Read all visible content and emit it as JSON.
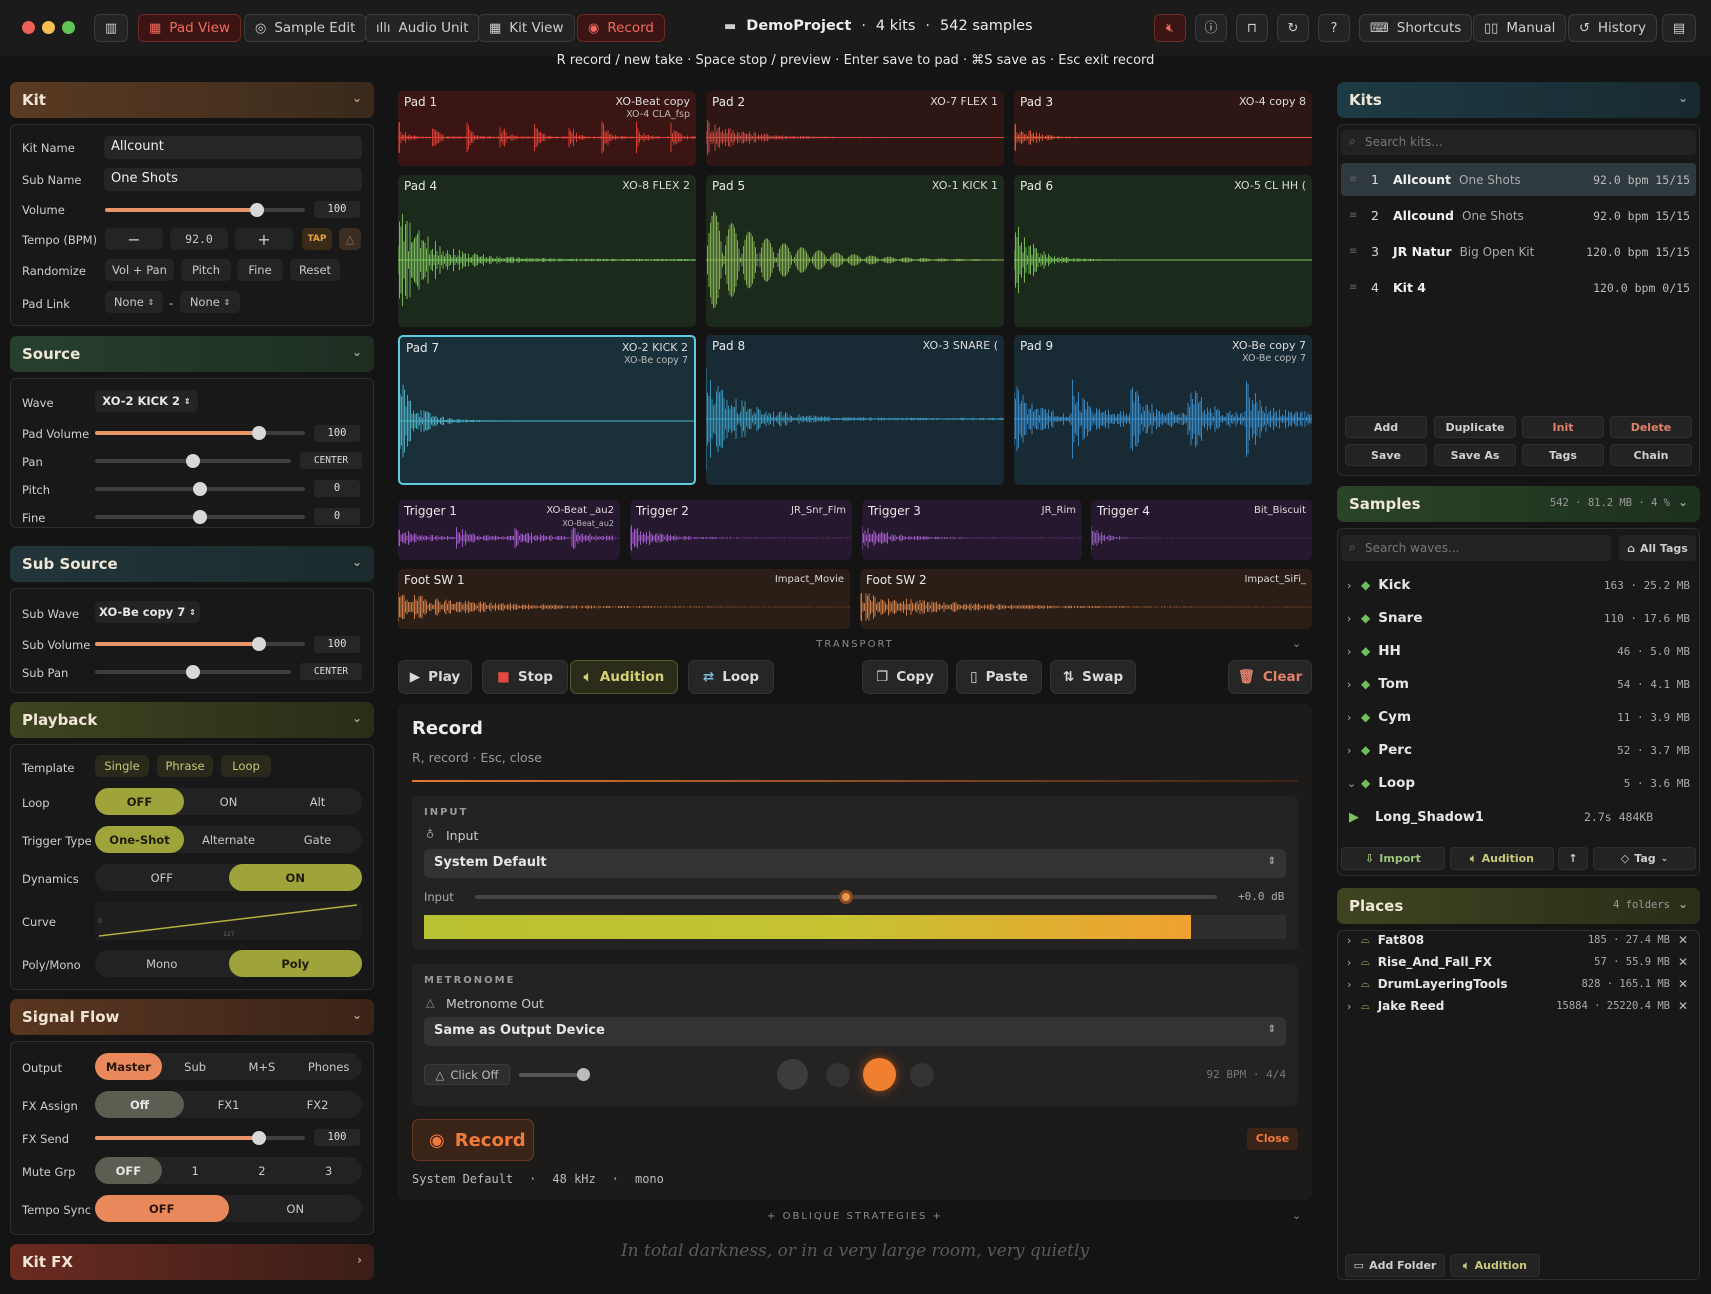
{
  "titlebar": {
    "tabs": [
      "Pad View",
      "Sample Edit",
      "Audio Unit",
      "Kit View",
      "Record"
    ],
    "project": "DemoProject",
    "kits": "4 kits",
    "samples": "542 samples",
    "shortcuts": "Shortcuts",
    "manual": "Manual",
    "history": "History"
  },
  "hint": "R record / new take · Space stop / preview · Enter save to pad · ⌘S save as · Esc exit record",
  "kit": {
    "title": "Kit",
    "kit_name_label": "Kit Name",
    "kit_name": "Allcount",
    "sub_name_label": "Sub Name",
    "sub_name": "One Shots",
    "volume_label": "Volume",
    "volume": "100",
    "volume_level": 0.76,
    "tempo_label": "Tempo (BPM)",
    "tempo": "92.0",
    "minus": "−",
    "plus": "+",
    "tap": "TAP",
    "randomize_label": "Randomize",
    "randomize": [
      "Vol + Pan",
      "Pitch",
      "Fine",
      "Reset"
    ],
    "padlink_label": "Pad Link",
    "padlink_a": "None",
    "padlink_sep": "-",
    "padlink_b": "None"
  },
  "source": {
    "title": "Source",
    "wave_label": "Wave",
    "wave": "XO-2 KICK 2",
    "padvol_label": "Pad Volume",
    "padvol": "100",
    "padvol_level": 0.78,
    "pan_label": "Pan",
    "pan": "CENTER",
    "pan_level": 0.5,
    "pitch_label": "Pitch",
    "pitch": "0",
    "pitch_level": 0.5,
    "fine_label": "Fine",
    "fine": "0",
    "fine_level": 0.5
  },
  "subsource": {
    "title": "Sub Source",
    "wave_label": "Sub Wave",
    "wave": "XO-Be copy 7",
    "vol_label": "Sub Volume",
    "vol": "100",
    "vol_level": 0.78,
    "pan_label": "Sub Pan",
    "pan": "CENTER",
    "pan_level": 0.5
  },
  "playback": {
    "title": "Playback",
    "template_label": "Template",
    "templates": [
      "Single",
      "Phrase",
      "Loop"
    ],
    "loop_label": "Loop",
    "loop": [
      "OFF",
      "ON",
      "Alt"
    ],
    "loop_on": 0,
    "trigger_label": "Trigger Type",
    "trigger": [
      "One-Shot",
      "Alternate",
      "Gate"
    ],
    "trigger_on": 0,
    "dynamics_label": "Dynamics",
    "dynamics": [
      "OFF",
      "ON"
    ],
    "dynamics_on": 1,
    "curve_label": "Curve",
    "curve_lo": "0",
    "curve_hi": "127",
    "poly_label": "Poly/Mono",
    "poly": [
      "Mono",
      "Poly"
    ],
    "poly_on": 1
  },
  "signal": {
    "title": "Signal Flow",
    "output_label": "Output",
    "output": [
      "Master",
      "Sub",
      "M+S",
      "Phones"
    ],
    "output_on": 0,
    "fx_label": "FX Assign",
    "fx": [
      "Off",
      "FX1",
      "FX2"
    ],
    "fx_on": 0,
    "send_label": "FX Send",
    "send": "100",
    "send_level": 0.78,
    "mute_label": "Mute Grp",
    "mute": [
      "OFF",
      "1",
      "2",
      "3"
    ],
    "mute_on": 0,
    "sync_label": "Tempo Sync",
    "sync": [
      "OFF",
      "ON"
    ],
    "sync_on": 0
  },
  "kitfx": {
    "title": "Kit FX"
  },
  "pads": [
    {
      "name": "Pad 1",
      "sample": "XO-Beat copy",
      "sub": "XO-4 CLA_fsp",
      "color": "#e5433a",
      "bg": "#3a1513"
    },
    {
      "name": "Pad 2",
      "sample": "XO-7 FLEX 1",
      "sub": "",
      "color": "#d24a44",
      "bg": "#2e1614"
    },
    {
      "name": "Pad 3",
      "sample": "XO-4  copy 8",
      "sub": "",
      "color": "#e45a3c",
      "bg": "#2e1614"
    },
    {
      "name": "Pad 4",
      "sample": "XO-8 FLEX 2",
      "sub": "",
      "color": "#7cc35e",
      "bg": "#1b2a1a"
    },
    {
      "name": "Pad 5",
      "sample": "XO-1 KICK 1",
      "sub": "",
      "color": "#89b556",
      "bg": "#1b2a1a"
    },
    {
      "name": "Pad 6",
      "sample": "XO-5 CL HH (",
      "sub": "",
      "color": "#7cc35e",
      "bg": "#1b2a1a"
    },
    {
      "name": "Pad 7",
      "sample": "XO-2 KICK 2",
      "sub": "XO-Be copy 7",
      "color": "#4eb7cc",
      "bg": "#19303a"
    },
    {
      "name": "Pad 8",
      "sample": "XO-3 SNARE (",
      "sub": "",
      "color": "#3d9cc4",
      "bg": "#182a33"
    },
    {
      "name": "Pad 9",
      "sample": "XO-Be copy 7",
      "sub": "XO-Be copy 7",
      "color": "#3a8fce",
      "bg": "#182a33"
    }
  ],
  "triggers": [
    {
      "name": "Trigger 1",
      "sample": "XO-Beat _au2",
      "sub": "XO-Beat_au2",
      "color": "#a058c8"
    },
    {
      "name": "Trigger 2",
      "sample": "JR_Snr_Flm",
      "sub": "",
      "color": "#a058c8"
    },
    {
      "name": "Trigger 3",
      "sample": "JR_Rim",
      "sub": "",
      "color": "#a058c8"
    },
    {
      "name": "Trigger 4",
      "sample": "Bit_Biscuit",
      "sub": "",
      "color": "#8a58b0"
    }
  ],
  "footsw": [
    {
      "name": "Foot SW 1",
      "sample": "Impact_Movie",
      "color": "#c77a48"
    },
    {
      "name": "Foot SW 2",
      "sample": "Impact_SiFi_",
      "color": "#c77a48"
    }
  ],
  "transport": {
    "label": "TRANSPORT",
    "play": "Play",
    "stop": "Stop",
    "audition": "Audition",
    "loop": "Loop",
    "copy": "Copy",
    "paste": "Paste",
    "swap": "Swap",
    "clear": "Clear"
  },
  "record": {
    "title": "Record",
    "hint": "R, record · Esc, close",
    "input_section": "INPUT",
    "input_label": "Input",
    "input_device": "System Default",
    "level_label": "Input",
    "level_db": "+0.0 dB",
    "level_knob": 0.5,
    "meter_level": 0.89,
    "metro_section": "METRONOME",
    "metro_label": "Metronome Out",
    "metro_device": "Same as Output Device",
    "click": "Click Off",
    "bpm": "92 BPM · 4/4",
    "record_btn": "Record",
    "close": "Close",
    "status": [
      "System Default",
      "48 kHz",
      "mono"
    ]
  },
  "oblique": {
    "label": "+ OBLIQUE STRATEGIES +",
    "text": "In total darkness, or in a very large room, very quietly"
  },
  "kits": {
    "title": "Kits",
    "search_placeholder": "Search kits...",
    "items": [
      {
        "num": "1",
        "name": "Allcount",
        "sub": "One Shots",
        "info": "92.0 bpm 15/15"
      },
      {
        "num": "2",
        "name": "Allcound",
        "sub": "One Shots",
        "info": "92.0 bpm 15/15"
      },
      {
        "num": "3",
        "name": "JR Natur",
        "sub": "Big Open Kit",
        "info": "120.0 bpm 15/15"
      },
      {
        "num": "4",
        "name": "Kit 4",
        "sub": "",
        "info": "120.0 bpm 0/15"
      }
    ],
    "actions": [
      "Add",
      "Duplicate",
      "Init",
      "Delete",
      "Save",
      "Save As",
      "Tags",
      "Chain"
    ]
  },
  "samples_panel": {
    "title": "Samples",
    "stats": "542 · 81.2 MB · 4 %",
    "search_placeholder": "Search waves...",
    "all_tags": "All Tags",
    "groups": [
      {
        "name": "Kick",
        "info": "163 · 25.2 MB"
      },
      {
        "name": "Snare",
        "info": "110 · 17.6 MB"
      },
      {
        "name": "HH",
        "info": "46 · 5.0 MB"
      },
      {
        "name": "Tom",
        "info": "54 · 4.1 MB"
      },
      {
        "name": "Cym",
        "info": "11 · 3.9 MB"
      },
      {
        "name": "Perc",
        "info": "52 · 3.7 MB"
      },
      {
        "name": "Loop",
        "info": "5 · 3.6 MB"
      }
    ],
    "file": {
      "name": "Long_Shadow1",
      "info": "2.7s 484KB"
    },
    "import": "Import",
    "audition": "Audition",
    "tag": "Tag"
  },
  "places": {
    "title": "Places",
    "stats": "4 folders",
    "items": [
      {
        "name": "Fat808",
        "info": "185 · 27.4 MB"
      },
      {
        "name": "Rise_And_Fall_FX",
        "info": "57 · 55.9 MB"
      },
      {
        "name": "DrumLayeringTools",
        "info": "828 · 165.1 MB"
      },
      {
        "name": "Jake Reed",
        "info": "15884 · 25220.4 MB"
      }
    ],
    "add_folder": "Add Folder",
    "audition": "Audition"
  }
}
